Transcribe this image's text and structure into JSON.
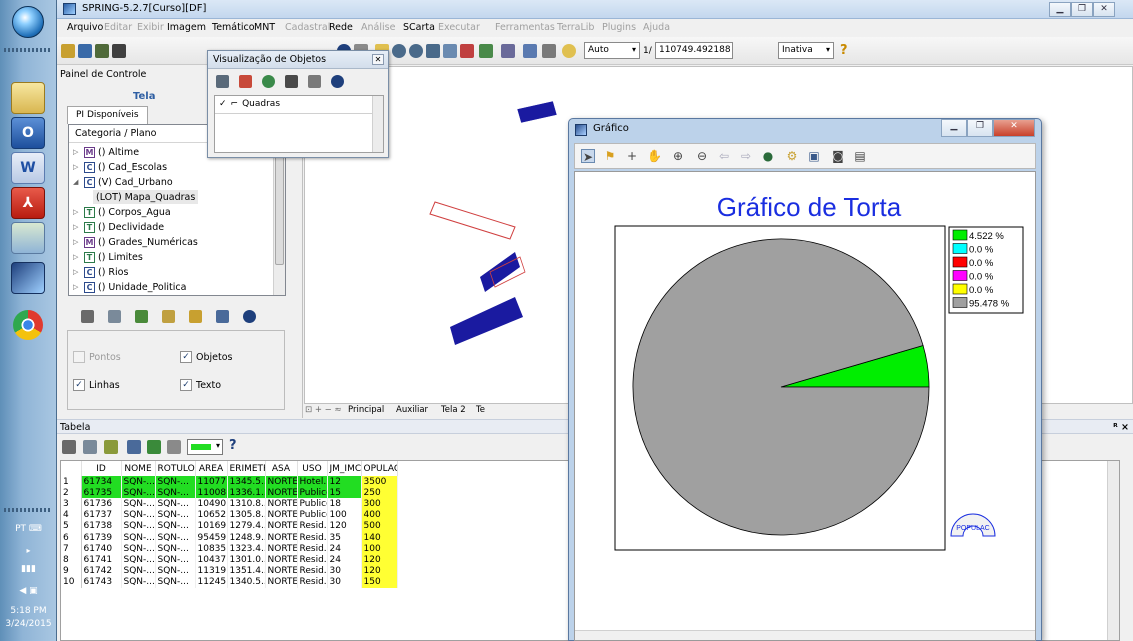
{
  "taskbar": {
    "clock_time": "5:18 PM",
    "clock_date": "3/24/2015",
    "language": "PT",
    "apps": [
      "word-icon",
      "pdf-icon",
      "network-icon",
      "spring-icon",
      "chrome-icon"
    ]
  },
  "window": {
    "title": "SPRING-5.2.7[Curso][DF]"
  },
  "menu": {
    "items": [
      "Arquivo",
      "Editar",
      "Exibir",
      "Imagem",
      "Temático",
      "MNT",
      "Cadastral",
      "Rede",
      "Análise",
      "SCarta",
      "Executar",
      "Ferramentas",
      "TerraLib",
      "Plugins",
      "Ajuda"
    ],
    "disabled": [
      false,
      true,
      true,
      false,
      false,
      false,
      true,
      false,
      true,
      false,
      true,
      true,
      true,
      true,
      true
    ]
  },
  "toolbar": {
    "zoom_mode": "Auto",
    "scale_prefix": "1/",
    "scale_value": "110749.492188",
    "status": "Inativa",
    "help_icon": "question-icon"
  },
  "painel": {
    "title": "Painel de Controle",
    "tela_label": "Tela",
    "tab": "PI Disponíveis",
    "tree_header": "Categoria / Plano",
    "tree": [
      {
        "marker": "M",
        "label": "() Altime",
        "color": "#6a3a8a"
      },
      {
        "marker": "C",
        "label": "() Cad_Escolas",
        "color": "#2c4a8c"
      },
      {
        "marker": "C",
        "label": "(V) Cad_Urbano",
        "color": "#2c4a8c"
      },
      {
        "marker": "",
        "label": "(LOT) Mapa_Quadras",
        "color": ""
      },
      {
        "marker": "T",
        "label": "() Corpos_Agua",
        "color": "#2c7a4a"
      },
      {
        "marker": "T",
        "label": "() Declividade",
        "color": "#2c7a4a"
      },
      {
        "marker": "M",
        "label": "() Grades_Numéricas",
        "color": "#6a3a8a"
      },
      {
        "marker": "T",
        "label": "() Limites",
        "color": "#2c7a4a"
      },
      {
        "marker": "C",
        "label": "() Rios",
        "color": "#2c4a8c"
      },
      {
        "marker": "C",
        "label": "() Unidade_Politica",
        "color": "#2c4a8c"
      }
    ],
    "checks": {
      "pontos": "Pontos",
      "objetos": "Objetos",
      "linhas": "Linhas",
      "texto": "Texto"
    }
  },
  "visualizacao": {
    "title": "Visualização de Objetos",
    "item": "Quadras"
  },
  "canvas_tabs": [
    "Principal",
    "Auxiliar",
    "Tela 2",
    "Te"
  ],
  "tabela": {
    "title": "Tabela",
    "columns": [
      "ID",
      "NOME",
      "ROTULO",
      "AREA",
      "ERIMETR",
      "ASA",
      "USO",
      "JM_IMC",
      "OPULAC"
    ],
    "rows": [
      {
        "n": "1",
        "cells": [
          "61734",
          "SQN-...",
          "SQN-...",
          "11077...",
          "1345.5...",
          "NORTE",
          "Hotel...",
          "12",
          "3500"
        ],
        "hl": true
      },
      {
        "n": "2",
        "cells": [
          "61735",
          "SQN-...",
          "SQN-...",
          "11008...",
          "1336.1...",
          "NORTE",
          "Publico",
          "15",
          "250"
        ],
        "hl": true
      },
      {
        "n": "3",
        "cells": [
          "61736",
          "SQN-...",
          "SQN-...",
          "10490...",
          "1310.8...",
          "NORTE",
          "Publico",
          "18",
          "300"
        ],
        "hl": false
      },
      {
        "n": "4",
        "cells": [
          "61737",
          "SQN-...",
          "SQN-...",
          "10652...",
          "1305.8...",
          "NORTE",
          "Publico",
          "100",
          "400"
        ],
        "hl": false
      },
      {
        "n": "5",
        "cells": [
          "61738",
          "SQN-...",
          "SQN-...",
          "10169...",
          "1279.4...",
          "NORTE",
          "Resid...",
          "120",
          "500"
        ],
        "hl": false
      },
      {
        "n": "6",
        "cells": [
          "61739",
          "SQN-...",
          "SQN-...",
          "95459....",
          "1248.9...",
          "NORTE",
          "Resid...",
          "35",
          "140"
        ],
        "hl": false
      },
      {
        "n": "7",
        "cells": [
          "61740",
          "SQN-...",
          "SQN-...",
          "10835...",
          "1323.4...",
          "NORTE",
          "Resid...",
          "24",
          "100"
        ],
        "hl": false
      },
      {
        "n": "8",
        "cells": [
          "61741",
          "SQN-...",
          "SQN-...",
          "10437...",
          "1301.0...",
          "NORTE",
          "Resid...",
          "24",
          "120"
        ],
        "hl": false
      },
      {
        "n": "9",
        "cells": [
          "61742",
          "SQN-...",
          "SQN-...",
          "11319...",
          "1351.4...",
          "NORTE",
          "Resid...",
          "30",
          "120"
        ],
        "hl": false
      },
      {
        "n": "10",
        "cells": [
          "61743",
          "SQN-...",
          "SQN-...",
          "11245...",
          "1340.5...",
          "NORTE",
          "Resid...",
          "30",
          "150"
        ],
        "hl": false
      }
    ]
  },
  "grafico": {
    "window_title": "Gráfico",
    "chart_title": "Gráfico de Torta",
    "badge_text": "POPULAC"
  },
  "chart_data": {
    "type": "pie",
    "title": "Gráfico de Torta",
    "slices": [
      {
        "label": "4.522 %",
        "value": 4.522,
        "color": "#00ee00"
      },
      {
        "label": "0.0 %",
        "value": 0.0,
        "color": "#00ffff"
      },
      {
        "label": "0.0 %",
        "value": 0.0,
        "color": "#ff0000"
      },
      {
        "label": "0.0 %",
        "value": 0.0,
        "color": "#ff00ff"
      },
      {
        "label": "0.0 %",
        "value": 0.0,
        "color": "#ffff00"
      },
      {
        "label": "95.478 %",
        "value": 95.478,
        "color": "#a0a0a0"
      }
    ],
    "legend_position": "top-right"
  }
}
